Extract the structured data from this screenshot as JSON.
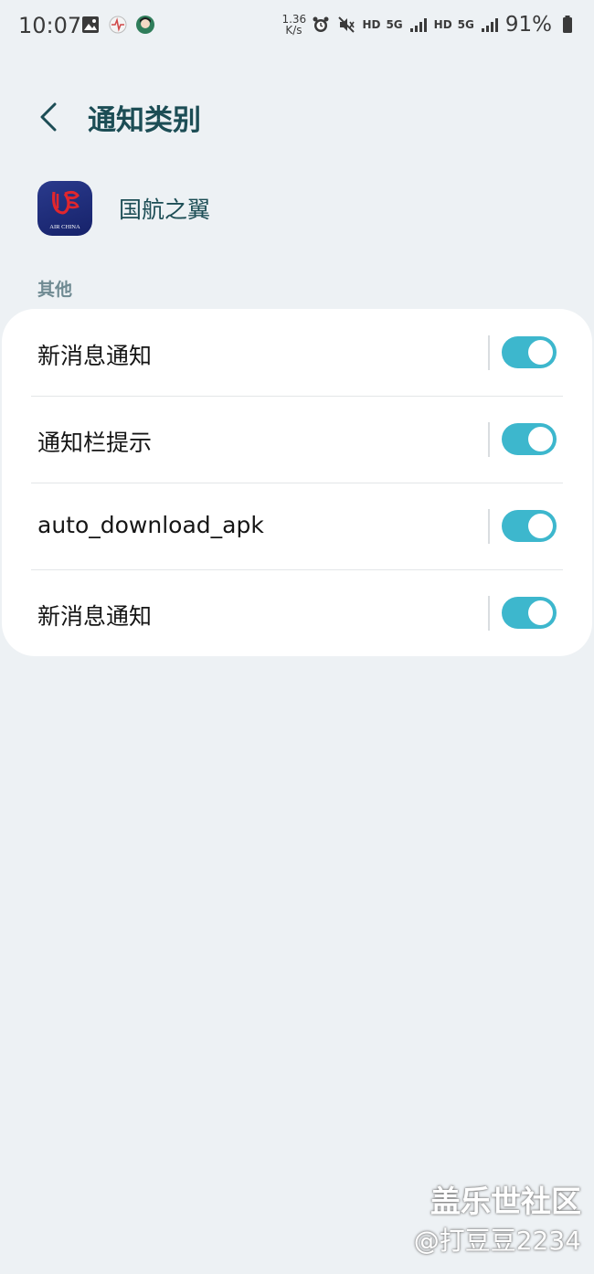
{
  "status_bar": {
    "time": "10:07",
    "net_speed_value": "1.36",
    "net_speed_unit": "K/s",
    "hd1": "HD",
    "network1": "5G",
    "hd2": "HD",
    "network2": "5G",
    "battery": "91%",
    "left_icons": [
      "image-icon",
      "app-notification-icon",
      "avatar-icon"
    ],
    "right_icons": [
      "alarm-icon",
      "mute-icon",
      "signal-icon",
      "signal-icon",
      "battery-icon"
    ]
  },
  "header": {
    "title": "通知类别"
  },
  "app": {
    "name": "国航之翼",
    "icon_caption": "AIR CHINA",
    "icon_color": "#1d2a78"
  },
  "section": {
    "label": "其他"
  },
  "settings": [
    {
      "label": "新消息通知",
      "enabled": true
    },
    {
      "label": "通知栏提示",
      "enabled": true
    },
    {
      "label": "auto_download_apk",
      "enabled": true
    },
    {
      "label": "新消息通知",
      "enabled": true
    }
  ],
  "colors": {
    "accent": "#3db7cd",
    "title": "#1c4d55",
    "background": "#edf1f4"
  },
  "watermark": {
    "line1": "盖乐世社区",
    "line2": "@打豆豆2234"
  }
}
